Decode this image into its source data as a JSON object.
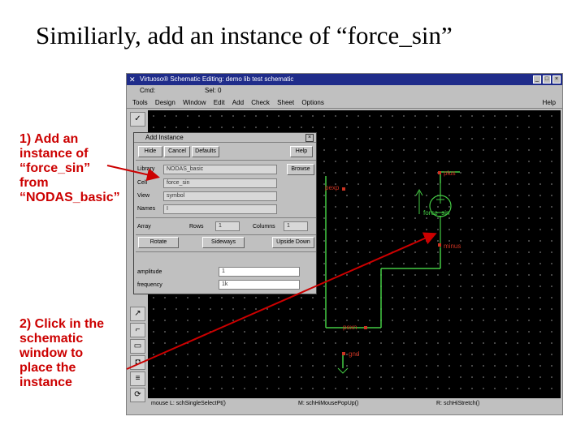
{
  "slide": {
    "title": "Similiarly, add an instance of “force_sin”",
    "callout1": [
      "1) Add an",
      "instance of",
      "“force_sin”",
      "from",
      "“NODAS_basic”"
    ],
    "callout2": [
      "2) Click in the",
      "schematic",
      "window to",
      "place the",
      "instance"
    ]
  },
  "window": {
    "title": "Virtuoso® Schematic Editing: demo lib test schematic",
    "controls": [
      "_",
      "□",
      "×"
    ],
    "status_left": "Cmd:",
    "status_right": "Sel: 0",
    "menus": [
      "Tools",
      "Design",
      "Window",
      "Edit",
      "Add",
      "Check",
      "Sheet",
      "Options"
    ],
    "help_menu": "Help",
    "footer_left": "mouse L: schSingleSelectPt()",
    "footer_mid": "M: schHiMousePopUp()",
    "footer_right": "R: schHiStretch()"
  },
  "schematic": {
    "labels": {
      "plus": "plus",
      "minus": "minus",
      "pexp": "pexp",
      "pexn": "pexn",
      "gnd": "gnd",
      "symbol": "force_sin"
    }
  },
  "dialog": {
    "title": "Add Instance",
    "close": "×",
    "buttons": {
      "hide": "Hide",
      "cancel": "Cancel",
      "defaults": "Defaults",
      "help": "Help",
      "browse": "Browse"
    },
    "fields": {
      "library_label": "Library",
      "library_value": "NODAS_basic",
      "cell_label": "Cell",
      "cell_value": "force_sin",
      "view_label": "View",
      "view_value": "symbol",
      "names_label": "Names",
      "names_value": "I"
    },
    "array": {
      "label": "Array",
      "rows_label": "Rows",
      "rows_value": "1",
      "columns_label": "Columns",
      "columns_value": "1"
    },
    "actions": {
      "rotate": "Rotate",
      "sideways": "Sideways",
      "upside_down": "Upside Down"
    },
    "params": {
      "amplitude_label": "amplitude",
      "amplitude_value": "1",
      "frequency_label": "frequency",
      "frequency_value": "1k"
    }
  },
  "colors": {
    "callout": "#cc0000",
    "titlebar": "#1f2c8a",
    "wire": "#44cc44",
    "pin": "#cc3322"
  }
}
